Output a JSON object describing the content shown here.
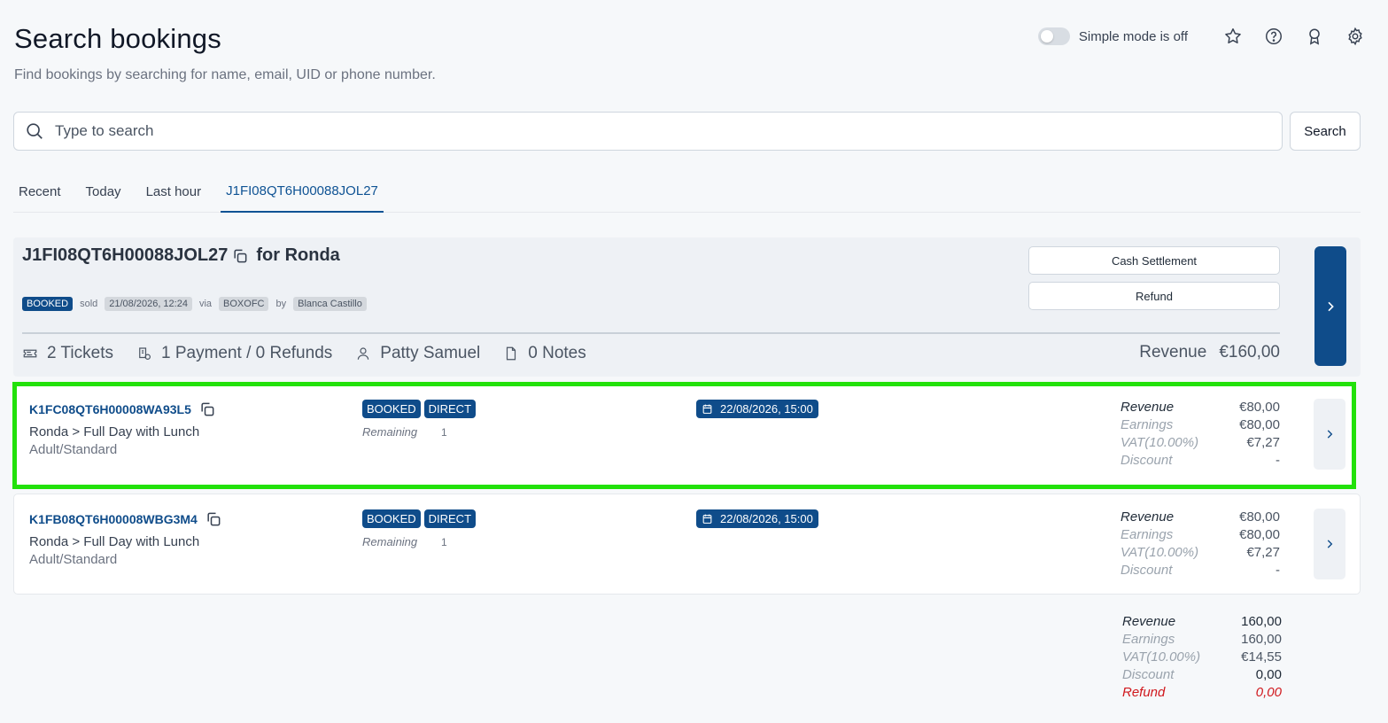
{
  "header": {
    "title": "Search bookings",
    "subtitle": "Find bookings by searching for name, email, UID or phone number.",
    "simple_mode_label": "Simple mode is off"
  },
  "search": {
    "placeholder": "Type to search",
    "button_label": "Search"
  },
  "tabs": [
    {
      "label": "Recent"
    },
    {
      "label": "Today"
    },
    {
      "label": "Last hour"
    },
    {
      "label": "J1FI08QT6H00088JOL27",
      "active": true
    }
  ],
  "booking": {
    "uid": "J1FI08QT6H00088JOL27",
    "for_label": "for Ronda",
    "status": "BOOKED",
    "sold_label": "sold",
    "sold_at": "21/08/2026, 12:24",
    "via_label": "via",
    "channel": "BOXOFC",
    "by_label": "by",
    "seller": "Blanca Castillo",
    "cash_settlement_label": "Cash Settlement",
    "refund_label": "Refund",
    "stats": {
      "tickets": "2 Tickets",
      "payments": "1 Payment / 0 Refunds",
      "customer": "Patty Samuel",
      "notes": "0 Notes"
    },
    "revenue_label": "Revenue",
    "revenue_value": "€160,00"
  },
  "tickets": [
    {
      "uid": "K1FC08QT6H00008WA93L5",
      "product": "Ronda > Full Day with Lunch",
      "type": "Adult/Standard",
      "status": "BOOKED",
      "channel": "DIRECT",
      "remaining_label": "Remaining",
      "remaining_value": "1",
      "date": "22/08/2026, 15:00",
      "revenue_label": "Revenue",
      "revenue": "€80,00",
      "earnings_label": "Earnings",
      "earnings": "€80,00",
      "vat_label": "VAT(10.00%)",
      "vat": "€7,27",
      "discount_label": "Discount",
      "discount": "-"
    },
    {
      "uid": "K1FB08QT6H00008WBG3M4",
      "product": "Ronda > Full Day with Lunch",
      "type": "Adult/Standard",
      "status": "BOOKED",
      "channel": "DIRECT",
      "remaining_label": "Remaining",
      "remaining_value": "1",
      "date": "22/08/2026, 15:00",
      "revenue_label": "Revenue",
      "revenue": "€80,00",
      "earnings_label": "Earnings",
      "earnings": "€80,00",
      "vat_label": "VAT(10.00%)",
      "vat": "€7,27",
      "discount_label": "Discount",
      "discount": "-"
    }
  ],
  "totals": {
    "revenue_label": "Revenue",
    "revenue": "160,00",
    "earnings_label": "Earnings",
    "earnings": "160,00",
    "vat_label": "VAT(10.00%)",
    "vat": "€14,55",
    "discount_label": "Discount",
    "discount": "0,00",
    "refund_label": "Refund",
    "refund": "0,00"
  },
  "colors": {
    "accent": "#0f4c8a",
    "highlight": "#22e10a",
    "refund_red": "#d0181d",
    "background": "#f6f8fa"
  },
  "icons": [
    "star-icon",
    "help-icon",
    "award-icon",
    "settings-icon",
    "search-icon",
    "copy-icon",
    "ticket-icon",
    "payment-icon",
    "user-icon",
    "note-icon",
    "calendar-icon",
    "chevron-right-icon"
  ]
}
